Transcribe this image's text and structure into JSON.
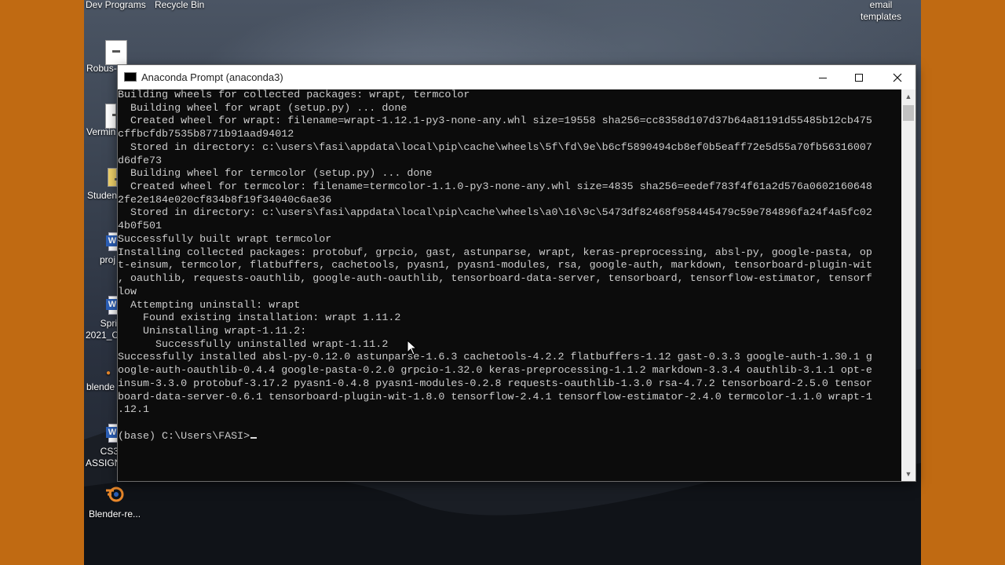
{
  "desktop": {
    "icons": [
      {
        "label": "Dev Programs"
      },
      {
        "label": "Recycle Bin"
      },
      {
        "label": "email\ntemplates"
      },
      {
        "label": "Robus-"
      },
      {
        "label": "Vermin"
      },
      {
        "label": "Studen"
      },
      {
        "label": "proj"
      },
      {
        "label": "Spri\n2021_C"
      },
      {
        "label": "blende"
      },
      {
        "label": "CS3\nASSIGN"
      },
      {
        "label": "Blender-re..."
      }
    ]
  },
  "window": {
    "title": "Anaconda Prompt (anaconda3)",
    "icon": "console-icon",
    "controls": {
      "minimize": "minimize-icon",
      "maximize": "maximize-icon",
      "close": "close-icon"
    }
  },
  "console": {
    "lines": [
      "Building wheels for collected packages: wrapt, termcolor",
      "  Building wheel for wrapt (setup.py) ... done",
      "  Created wheel for wrapt: filename=wrapt-1.12.1-py3-none-any.whl size=19558 sha256=cc8358d107d37b64a81191d55485b12cb475",
      "cffbcfdb7535b8771b91aad94012",
      "  Stored in directory: c:\\users\\fasi\\appdata\\local\\pip\\cache\\wheels\\5f\\fd\\9e\\b6cf5890494cb8ef0b5eaff72e5d55a70fb56316007",
      "d6dfe73",
      "  Building wheel for termcolor (setup.py) ... done",
      "  Created wheel for termcolor: filename=termcolor-1.1.0-py3-none-any.whl size=4835 sha256=eedef783f4f61a2d576a0602160648",
      "2fe2e184e020cf834b8f19f34040c6ae36",
      "  Stored in directory: c:\\users\\fasi\\appdata\\local\\pip\\cache\\wheels\\a0\\16\\9c\\5473df82468f958445479c59e784896fa24f4a5fc02",
      "4b0f501",
      "Successfully built wrapt termcolor",
      "Installing collected packages: protobuf, grpcio, gast, astunparse, wrapt, keras-preprocessing, absl-py, google-pasta, op",
      "t-einsum, termcolor, flatbuffers, cachetools, pyasn1, pyasn1-modules, rsa, google-auth, markdown, tensorboard-plugin-wit",
      ", oauthlib, requests-oauthlib, google-auth-oauthlib, tensorboard-data-server, tensorboard, tensorflow-estimator, tensorf",
      "low",
      "  Attempting uninstall: wrapt",
      "    Found existing installation: wrapt 1.11.2",
      "    Uninstalling wrapt-1.11.2:",
      "      Successfully uninstalled wrapt-1.11.2",
      "Successfully installed absl-py-0.12.0 astunparse-1.6.3 cachetools-4.2.2 flatbuffers-1.12 gast-0.3.3 google-auth-1.30.1 g",
      "oogle-auth-oauthlib-0.4.4 google-pasta-0.2.0 grpcio-1.32.0 keras-preprocessing-1.1.2 markdown-3.3.4 oauthlib-3.1.1 opt-e",
      "insum-3.3.0 protobuf-3.17.2 pyasn1-0.4.8 pyasn1-modules-0.2.8 requests-oauthlib-1.3.0 rsa-4.7.2 tensorboard-2.5.0 tensor",
      "board-data-server-0.6.1 tensorboard-plugin-wit-1.8.0 tensorflow-2.4.1 tensorflow-estimator-2.4.0 termcolor-1.1.0 wrapt-1",
      ".12.1",
      "",
      "(base) C:\\Users\\FASI>"
    ],
    "text_color": "#cccccc",
    "background": "#0c0c0c"
  },
  "colors": {
    "frame": "#c06a12",
    "titlebar": "#ffffff",
    "scrollbar": "#f0f0f0"
  }
}
